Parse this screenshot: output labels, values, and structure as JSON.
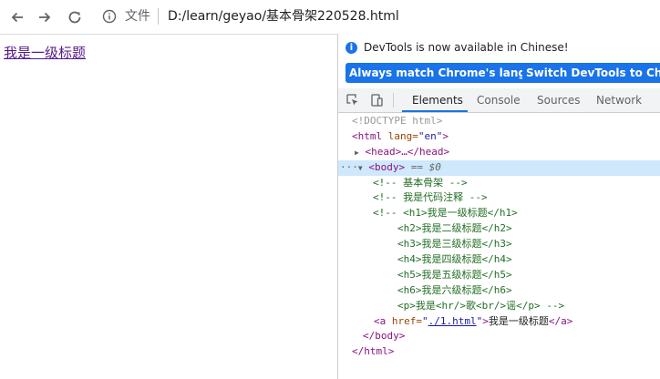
{
  "browser": {
    "back_icon": "arrow-left-icon",
    "forward_icon": "arrow-right-icon",
    "reload_icon": "reload-icon",
    "file_label": "文件",
    "url": "D:/learn/geyao/基本骨架220528.html"
  },
  "page": {
    "link_text": "我是一级标题"
  },
  "devtools": {
    "banner": {
      "message": "DevTools is now available in Chinese!",
      "btn_match": "Always match Chrome's language",
      "btn_switch": "Switch DevTools to Chinese"
    },
    "tabs": [
      "Elements",
      "Console",
      "Sources",
      "Network"
    ],
    "tree": {
      "doctype": "<!DOCTYPE html>",
      "html_open_tag": "<html",
      "lang_attr": " lang=",
      "lang_val": "\"en\"",
      "html_open_close": ">",
      "head_collapsed": "<head>…</head>",
      "body_open": "<body>",
      "body_eq": " == $0",
      "comment1": "<!-- 基本骨架 -->",
      "comment2": "<!-- 我是代码注释 -->",
      "comment3_l1": "<!-- <h1>我是一级标题</h1>",
      "comment3_l2": "<h2>我是二级标题</h2>",
      "comment3_l3": "<h3>我是三级标题</h3>",
      "comment3_l4": "<h4>我是四级标题</h4>",
      "comment3_l5": "<h5>我是五级标题</h5>",
      "comment3_l6": "<h6>我是六级标题</h6>",
      "comment3_l7": "<p>我是<hr/>歌<br/>谣</p> -->",
      "a_open": "<a",
      "a_href_attr": " href=",
      "a_q1": "\"",
      "a_href_val": "./1.html",
      "a_q2": "\"",
      "a_gt": ">",
      "a_text": "我是一级标题",
      "a_close": "</a>",
      "body_close": "</body>",
      "html_close": "</html>"
    }
  }
}
